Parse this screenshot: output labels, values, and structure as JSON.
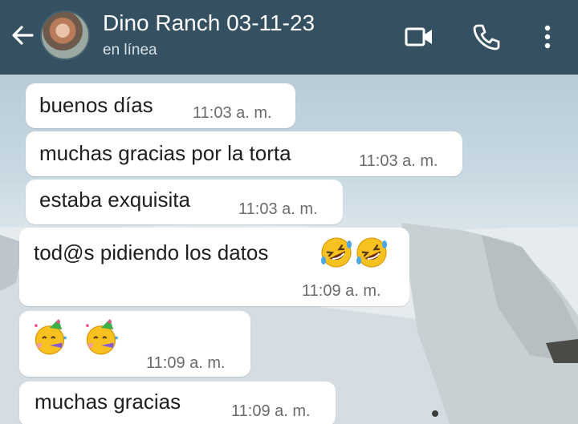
{
  "header": {
    "back_icon": "arrow-back-icon",
    "title": "Dino Ranch 03-11-23",
    "status": "en línea",
    "video_icon": "video-call-icon",
    "phone_icon": "phone-call-icon",
    "menu_icon": "more-vert-icon",
    "background_color": "#355161"
  },
  "messages": [
    {
      "text": "buenos días",
      "time": "11:03 a. m."
    },
    {
      "text": "muchas gracias por la torta",
      "time": "11:03 a. m."
    },
    {
      "text": "estaba exquisita",
      "time": "11:03 a. m."
    },
    {
      "text": "tod@s pidiendo los datos",
      "emoji": "rolling-on-floor-laughing-emoji",
      "time": "11:09 a. m."
    },
    {
      "emoji": "partying-face-emoji",
      "time": "11:09 a. m."
    },
    {
      "text": "muchas gracias",
      "time": "11:09 a. m."
    }
  ]
}
